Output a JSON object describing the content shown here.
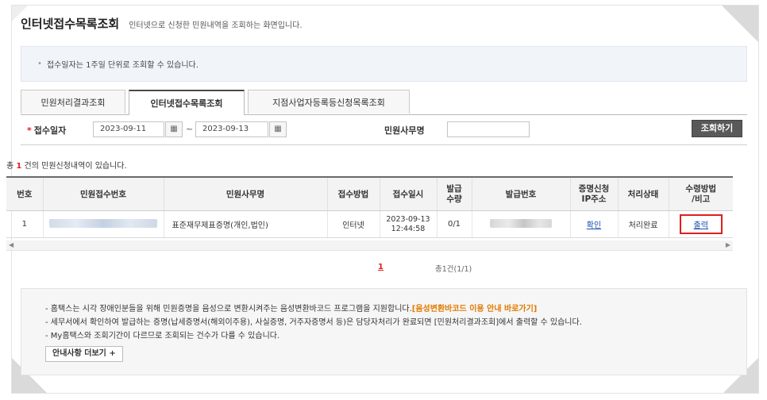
{
  "page": {
    "title": "인터넷접수목록조회",
    "subtitle": "인터넷으로 신청한 민원내역을 조회하는 화면입니다."
  },
  "notice": "접수일자는 1주일 단위로 조회할 수 있습니다.",
  "tabs": [
    {
      "label": "민원처리결과조회"
    },
    {
      "label": "인터넷접수목록조회",
      "active": true
    },
    {
      "label": "지점사업자등록등신청목록조회"
    }
  ],
  "search": {
    "date_label": "접수일자",
    "required_mark": "*",
    "date_from": "2023-09-11",
    "date_sep": "~",
    "date_to": "2023-09-13",
    "service_label": "민원사무명",
    "service_value": "",
    "button": "조회하기"
  },
  "result": {
    "prefix": "총",
    "count": "1",
    "suffix": "건의 민원신청내역이 있습니다."
  },
  "table": {
    "headers": [
      "번호",
      "민원접수번호",
      "민원사무명",
      "접수방법",
      "접수일시",
      "발급\n수량",
      "발급번호",
      "증명신청\nIP주소",
      "처리상태",
      "수령방법\n/비고"
    ],
    "rows": [
      {
        "no": "1",
        "service": "표준재무제표증명(개인,법인)",
        "method": "인터넷",
        "date": "2023-09-13",
        "time": "12:44:58",
        "qty": "0/1",
        "ip": "확인",
        "status": "처리완료",
        "receive": "출력"
      }
    ]
  },
  "pagination": {
    "current": "1",
    "total": "총1건(1/1)"
  },
  "guide": {
    "line1": "- 홈택스는 시각 장애인분들을 위해 민원증명을 음성으로 변환시켜주는 음성변환바코드 프로그램을 지원합니다.",
    "line1_link": "[음성변환바코드 이용 안내 바로가기]",
    "line2": "- 세무서에서 확인하여 발급하는 증명(납세증명서(해외이주용), 사실증명, 거주자증명서 등)은 담당자처리가 완료되면 [민원처리결과조회]에서 출력할 수 있습니다.",
    "line3": "- My홈택스와 조회기간이 다르므로 조회되는 건수가 다를 수 있습니다.",
    "more_button": "안내사항 더보기 +"
  },
  "colors": {
    "accent_red": "#e01e1e",
    "link_blue": "#1a4fb0",
    "highlight_orange": "#e07a00",
    "button_dark": "#595959"
  }
}
